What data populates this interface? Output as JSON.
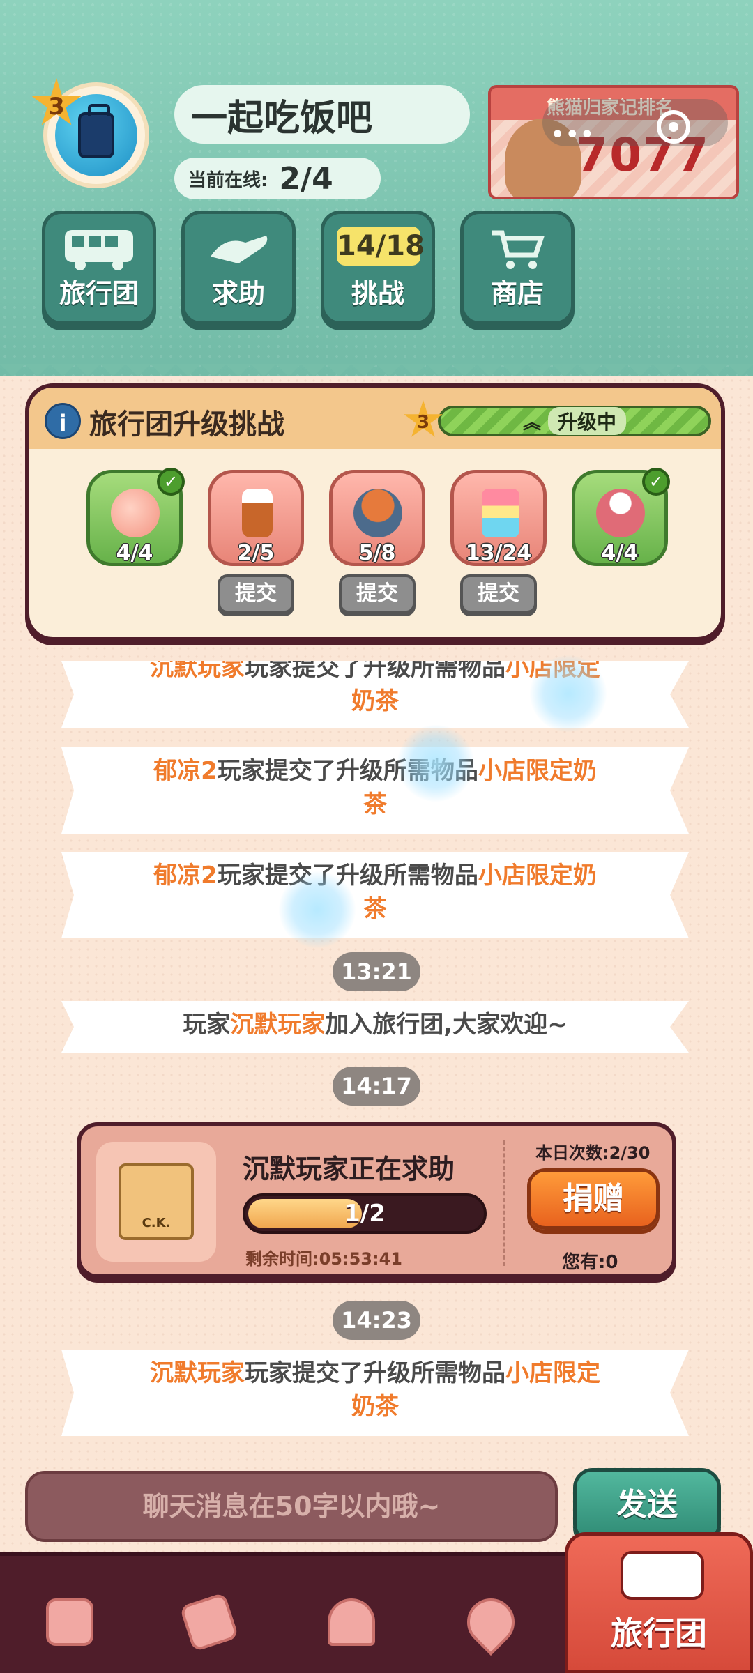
{
  "header": {
    "level": "3",
    "group_name": "一起吃饭吧",
    "online_label": "当前在线:",
    "online_value": "2/4",
    "rank_title": "熊猫归家记排名",
    "rank_value": "7077",
    "menu_dots": "•••"
  },
  "nav": [
    {
      "label": "旅行团",
      "icon": "bus-icon"
    },
    {
      "label": "求助",
      "icon": "helping-hand-icon"
    },
    {
      "label": "挑战",
      "icon": "challenge-counter",
      "count": "14/18"
    },
    {
      "label": "商店",
      "icon": "cart-icon"
    }
  ],
  "challenge": {
    "title": "旅行团升级挑战",
    "level": "3",
    "status": "升级中",
    "items": [
      {
        "name": "peach",
        "qty": "4/4",
        "done": true
      },
      {
        "name": "bottle",
        "qty": "2/5",
        "done": false,
        "action": "提交"
      },
      {
        "name": "cake",
        "qty": "5/8",
        "done": false,
        "action": "提交"
      },
      {
        "name": "milk-tea",
        "qty": "13/24",
        "done": false,
        "action": "提交"
      },
      {
        "name": "figurine",
        "qty": "4/4",
        "done": true
      }
    ]
  },
  "feed": {
    "msg1": {
      "player": "沉默玩家",
      "mid": "玩家提交了升级所需物品",
      "item": "小店限定",
      "tail": "奶茶"
    },
    "msg2": {
      "player": "郁凉2",
      "mid": "玩家提交了升级所需物品",
      "item": "小店限定奶",
      "tail": "茶"
    },
    "msg3": {
      "player": "郁凉2",
      "mid": "玩家提交了升级所需物品",
      "item": "小店限定奶",
      "tail": "茶"
    },
    "time1": "13:21",
    "msg4": {
      "pre": "玩家",
      "player": "沉默玩家",
      "post": "加入旅行团,大家欢迎~"
    },
    "time2": "14:17",
    "time3": "14:23",
    "msg5": {
      "player": "沉默玩家",
      "mid": "玩家提交了升级所需物品",
      "item": "小店限定",
      "tail": "奶茶"
    }
  },
  "help": {
    "who": "沉默玩家正在求助",
    "progress_text": "1/2",
    "progress_fraction": 0.5,
    "remaining": "剩余时间:05:53:41",
    "daily": "本日次数:2/30",
    "donate": "捐赠",
    "have": "您有:0",
    "item_label": "C.K."
  },
  "input": {
    "placeholder": "聊天消息在50字以内哦~",
    "send": "发送"
  },
  "tabs": {
    "active_label": "旅行团",
    "icons": [
      "bag-icon",
      "tickets-icon",
      "service-bell-icon",
      "map-pin-icon"
    ]
  },
  "colors": {
    "highlight": "#f07b2c",
    "header_green": "#7cc6b2",
    "panel_border": "#4f1d2a"
  }
}
